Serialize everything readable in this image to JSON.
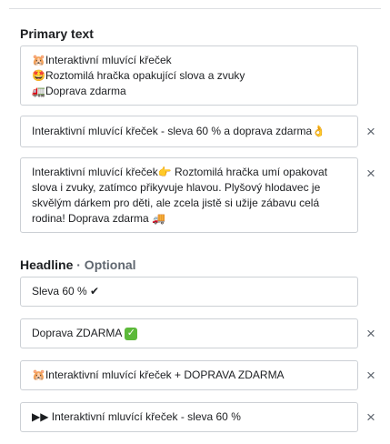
{
  "primary_text": {
    "title": "Primary text",
    "fields": [
      {
        "lines": [
          "🐹Interaktivní mluvící křeček",
          "🤩Roztomilá hračka opakující slova a zvuky",
          "🚛Doprava zdarma"
        ]
      },
      {
        "value": "Interaktivní mluvící křeček - sleva 60 % a doprava zdarma👌"
      },
      {
        "lines": [
          "Interaktivní mluvící křeček👉 Roztomilá hračka umí opakovat",
          "slova i zvuky, zatímco přikyvuje hlavou. Plyšový hlodavec je",
          "skvělým dárkem pro děti, ale zcela jistě si užije zábavu celá",
          "rodina! Doprava zdarma 🚚"
        ]
      }
    ]
  },
  "headline": {
    "title": "Headline",
    "optional_label": "· Optional",
    "fields": [
      {
        "value": "Sleva 60 % ✔"
      },
      {
        "value": "Doprava ZDARMA",
        "badge": "✓"
      },
      {
        "value": "🐹Interaktivní mluvící křeček + DOPRAVA ZDARMA"
      },
      {
        "value": "▶▶ Interaktivní mluvící křeček - sleva 60 %"
      }
    ]
  },
  "remove_icon": "×",
  "colors": {
    "border": "#ccd0d5",
    "text": "#1c1e21",
    "muted": "#606770",
    "check_badge": "#5cb93a"
  }
}
